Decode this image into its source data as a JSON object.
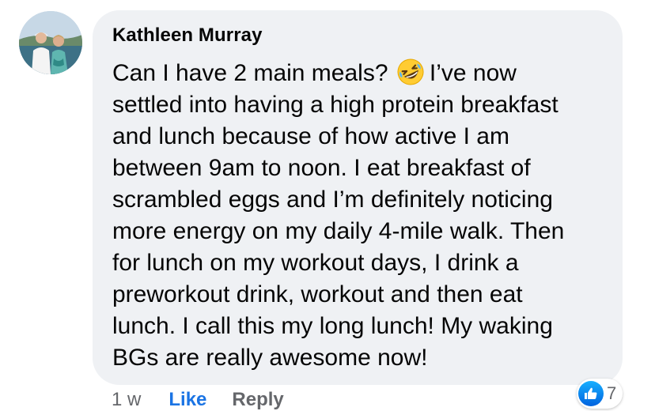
{
  "comment": {
    "author": "Kathleen Murray",
    "text_lines": [
      "Can I have 2 main meals?",
      "I’ve now",
      "settled into having a high protein breakfast",
      "and lunch because of how active I am",
      "between 9am to noon. I eat breakfast of",
      "scrambled eggs and I’m definitely noticing",
      "more energy on my daily 4-mile walk. Then",
      "for lunch on my workout days, I drink a",
      "preworkout drink, workout and then eat",
      "lunch. I call this my long lunch! My waking",
      "BGs are really awesome now!"
    ],
    "emoji": "rolling-on-floor-laughing-emoji"
  },
  "actions": {
    "time": "1 w",
    "like_label": "Like",
    "reply_label": "Reply"
  },
  "reactions": {
    "icon": "thumbs-up-icon",
    "count": "7",
    "color": "#1877f2"
  }
}
